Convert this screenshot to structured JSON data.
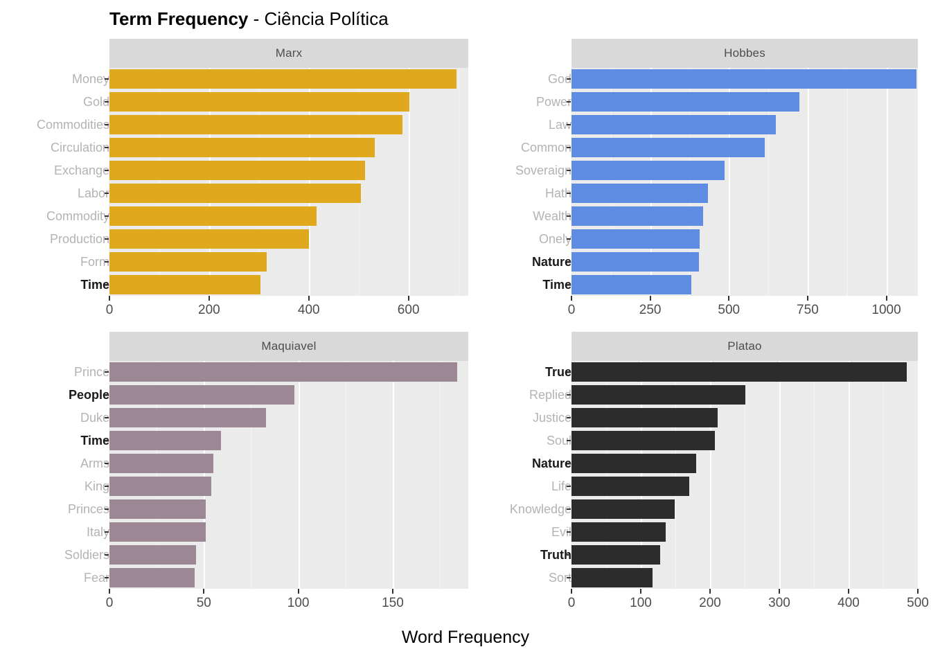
{
  "title": {
    "bold_part": "Term Frequency",
    "rest_part": " - Ciência Política"
  },
  "axis_titles": {
    "x": "Word Frequency",
    "y": ""
  },
  "colors": {
    "marx": "#E0A81D",
    "hobbes": "#5F8CE3",
    "maquiavel": "#9C8794",
    "platao": "#2C2C2C",
    "panel_background": "#EBEBEB",
    "strip_background": "#D9D9D9",
    "gridline": "#FFFFFF",
    "label_muted": "#B3B3B3",
    "label_strong": "#1A1A1A"
  },
  "chart_data": {
    "type": "bar",
    "title": "Term Frequency - Ciência Política",
    "xlabel": "Word Frequency",
    "ylabel": "",
    "orientation": "horizontal",
    "grid": true,
    "legend": "none",
    "facets": [
      {
        "name": "Marx",
        "color": "#E0A81D",
        "xlim": [
          0,
          720
        ],
        "xticks": [
          0,
          200,
          400,
          600
        ],
        "xtick_labels": [
          "0",
          "200",
          "400",
          "600"
        ],
        "categories": [
          "Money",
          "Gold",
          "Commodities",
          "Circulation",
          "Exchange",
          "Labor",
          "Commodity",
          "Production",
          "Form",
          "Time"
        ],
        "values": [
          697,
          602,
          588,
          532,
          513,
          505,
          415,
          400,
          316,
          303
        ],
        "highlighted": [
          "Time"
        ]
      },
      {
        "name": "Hobbes",
        "color": "#5F8CE3",
        "xlim": [
          0,
          1100
        ],
        "xticks": [
          0,
          250,
          500,
          750,
          1000
        ],
        "xtick_labels": [
          "0",
          "250",
          "500",
          "750",
          "1000"
        ],
        "categories": [
          "God",
          "Power",
          "Law",
          "Common",
          "Soveraign",
          "Hath",
          "Wealth",
          "Onely",
          "Nature",
          "Time"
        ],
        "values": [
          1095,
          723,
          650,
          613,
          487,
          433,
          418,
          408,
          404,
          380
        ],
        "highlighted": [
          "Nature",
          "Time"
        ]
      },
      {
        "name": "Maquiavel",
        "color": "#9C8794",
        "xlim": [
          0,
          190
        ],
        "xticks": [
          0,
          50,
          100,
          150
        ],
        "xtick_labels": [
          "0",
          "50",
          "100",
          "150"
        ],
        "categories": [
          "Prince",
          "People",
          "Duke",
          "Time",
          "Arms",
          "King",
          "Princes",
          "Italy",
          "Soldiers",
          "Fear"
        ],
        "values": [
          184,
          98,
          83,
          59,
          55,
          54,
          51,
          51,
          46,
          45
        ],
        "highlighted": [
          "People",
          "Time"
        ]
      },
      {
        "name": "Platao",
        "color": "#2C2C2C",
        "xlim": [
          0,
          500
        ],
        "xticks": [
          0,
          100,
          200,
          300,
          400,
          500
        ],
        "xtick_labels": [
          "0",
          "100",
          "200",
          "300",
          "400",
          "500"
        ],
        "categories": [
          "True",
          "Replied",
          "Justice",
          "Soul",
          "Nature",
          "Life",
          "Knowledge",
          "Evil",
          "Truth",
          "Sort"
        ],
        "values": [
          484,
          251,
          211,
          207,
          180,
          170,
          149,
          136,
          128,
          117
        ],
        "highlighted": [
          "True",
          "Nature",
          "Truth"
        ]
      }
    ]
  }
}
